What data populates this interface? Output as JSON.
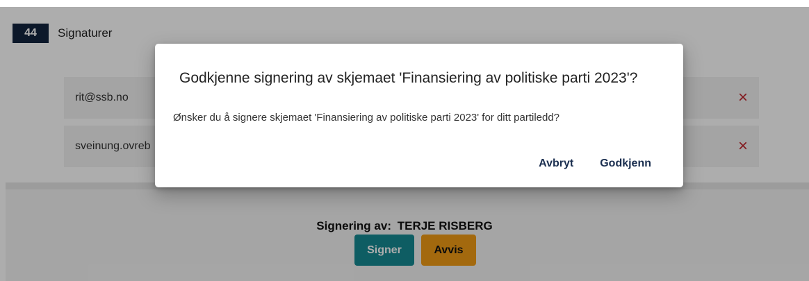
{
  "section": {
    "number": "44",
    "title": "Signaturer"
  },
  "signers": [
    {
      "email": "rit@ssb.no",
      "remove_icon": "×"
    },
    {
      "email": "sveinung.ovreb",
      "remove_icon": "×"
    }
  ],
  "signing": {
    "label": "Signering av:",
    "name": "TERJE RISBERG",
    "sign_button": "Signer",
    "reject_button": "Avvis"
  },
  "dialog": {
    "title": "Godkjenne signering av skjemaet 'Finansiering av politiske parti 2023'?",
    "body": "Ønsker du å signere skjemaet 'Finansiering av politiske parti 2023' for ditt partiledd?",
    "cancel_label": "Avbryt",
    "confirm_label": "Godkjenn"
  },
  "colors": {
    "section_badge": "#12243f",
    "remove_icon": "#c0262d",
    "signer_button": "#158a93",
    "reject_button": "#f09b16",
    "dialog_button_text": "#1a2e4f"
  }
}
